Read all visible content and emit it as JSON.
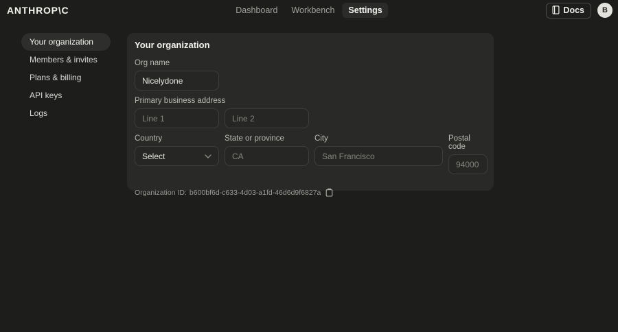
{
  "header": {
    "logo": "ANTHROP\\C",
    "nav": [
      {
        "label": "Dashboard",
        "active": false
      },
      {
        "label": "Workbench",
        "active": false
      },
      {
        "label": "Settings",
        "active": true
      }
    ],
    "docs_button": "Docs",
    "avatar_initial": "B"
  },
  "sidebar": {
    "items": [
      {
        "label": "Your organization",
        "active": true
      },
      {
        "label": "Members & invites",
        "active": false
      },
      {
        "label": "Plans & billing",
        "active": false
      },
      {
        "label": "API keys",
        "active": false
      },
      {
        "label": "Logs",
        "active": false
      }
    ]
  },
  "main": {
    "title": "Your organization",
    "org_name": {
      "label": "Org name",
      "value": "Nicelydone"
    },
    "address": {
      "label": "Primary business address",
      "line1_placeholder": "Line 1",
      "line2_placeholder": "Line 2"
    },
    "country": {
      "label": "Country",
      "value": "Select"
    },
    "state": {
      "label": "State or province",
      "placeholder": "CA"
    },
    "city": {
      "label": "City",
      "placeholder": "San Francisco"
    },
    "postal": {
      "label": "Postal code",
      "placeholder": "94000"
    },
    "org_id": {
      "label": "Organization ID:",
      "value": "b600bf6d-c633-4d03-a1fd-46d6d9f6827a"
    }
  },
  "colors": {
    "page_bg": "#1d1d1c",
    "panel_bg": "#292927",
    "input_bg": "#262624",
    "input_border": "#3e3e3c",
    "active_pill_bg": "#2e2e2c",
    "avatar_bg": "#e4e2dd",
    "text_primary": "#f4f3ef",
    "text_muted": "#9d9c97"
  }
}
